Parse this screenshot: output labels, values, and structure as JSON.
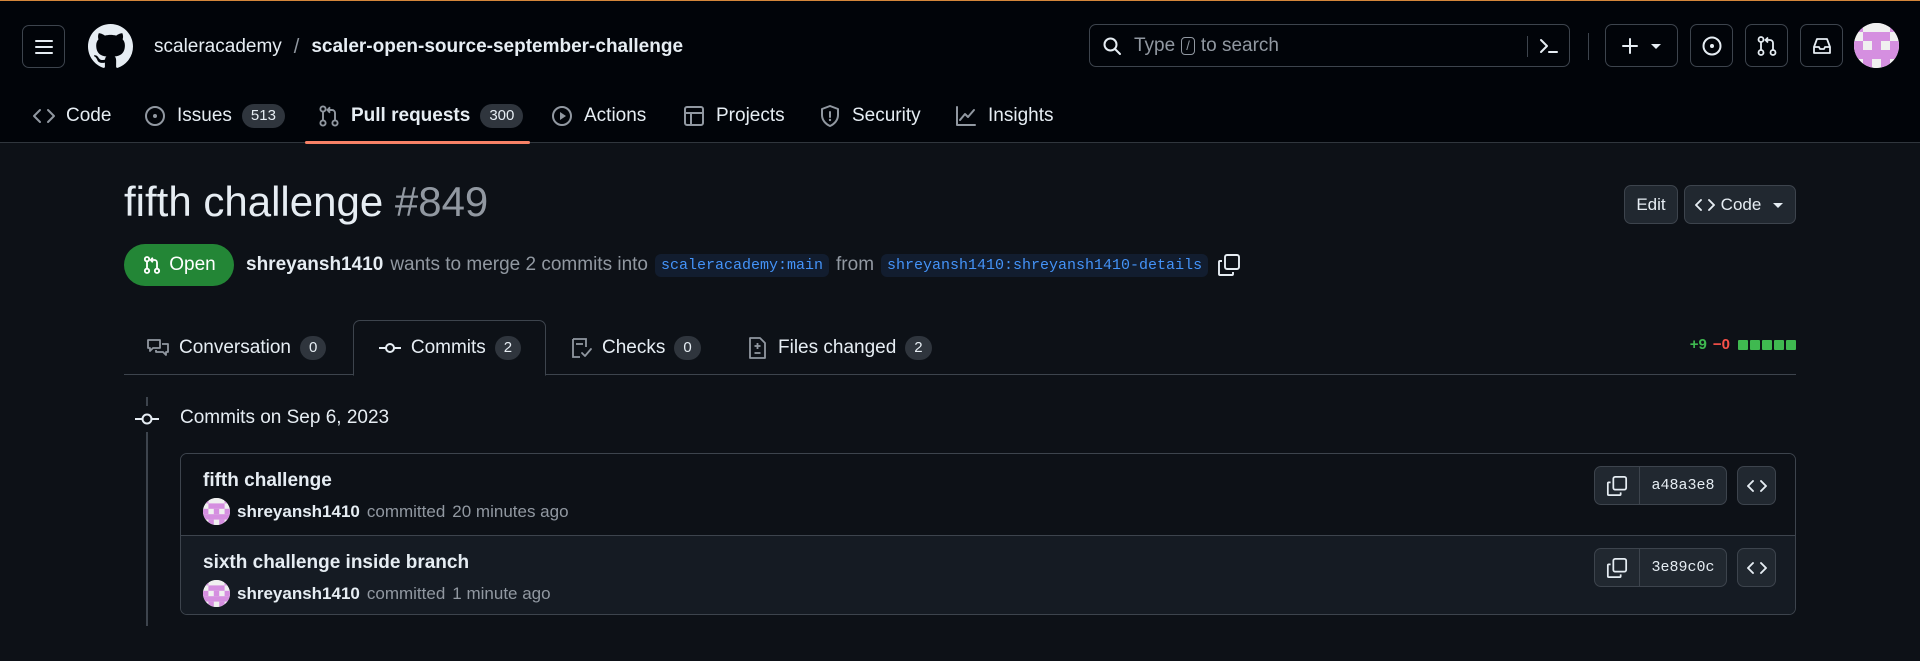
{
  "header": {
    "repo_owner": "scaleracademy",
    "repo_separator": "/",
    "repo_name": "scaler-open-source-september-challenge",
    "search_prefix": "Type",
    "search_key": "/",
    "search_suffix": "to search"
  },
  "nav": {
    "code": "Code",
    "issues": "Issues",
    "issues_count": "513",
    "pulls": "Pull requests",
    "pulls_count": "300",
    "actions": "Actions",
    "projects": "Projects",
    "security": "Security",
    "insights": "Insights"
  },
  "pr": {
    "title": "fifth challenge",
    "number": "#849",
    "edit_label": "Edit",
    "code_label": "Code",
    "state": "Open",
    "author": "shreyansh1410",
    "merge_text": "wants to merge 2 commits into",
    "base_branch": "scaleracademy:main",
    "from_text": "from",
    "head_branch": "shreyansh1410:shreyansh1410-details"
  },
  "tabs": {
    "conversation": "Conversation",
    "conversation_count": "0",
    "commits": "Commits",
    "commits_count": "2",
    "checks": "Checks",
    "checks_count": "0",
    "files": "Files changed",
    "files_count": "2",
    "additions": "+9",
    "deletions": "−0"
  },
  "commits": {
    "date_heading": "Commits on Sep 6, 2023",
    "items": [
      {
        "title": "fifth challenge",
        "author": "shreyansh1410",
        "action": "committed",
        "time": "20 minutes ago",
        "sha": "a48a3e8"
      },
      {
        "title": "sixth challenge inside branch",
        "author": "shreyansh1410",
        "action": "committed",
        "time": "1 minute ago",
        "sha": "3e89c0c"
      }
    ]
  },
  "colors": {
    "background": "#0d1117",
    "header_bg": "#010409",
    "open_badge": "#238636",
    "active_tab_underline": "#f78166",
    "additions": "#3fb950",
    "deletions": "#f85149",
    "link_blue": "#4493f8"
  }
}
